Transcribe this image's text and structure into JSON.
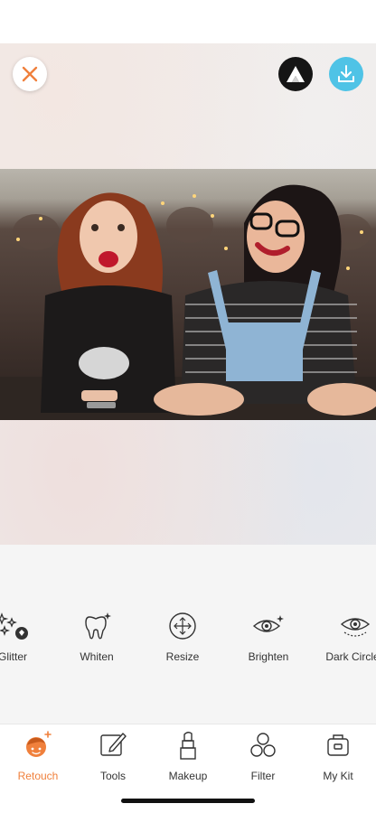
{
  "tools": [
    {
      "label": "Glitter",
      "icon": "glitter-icon"
    },
    {
      "label": "Whiten",
      "icon": "tooth-icon"
    },
    {
      "label": "Resize",
      "icon": "resize-icon"
    },
    {
      "label": "Brighten",
      "icon": "brighten-eye-icon"
    },
    {
      "label": "Dark Circles",
      "icon": "dark-circles-eye-icon"
    }
  ],
  "nav": [
    {
      "label": "Retouch",
      "icon": "retouch-face-icon",
      "active": true
    },
    {
      "label": "Tools",
      "icon": "pencil-edit-icon",
      "active": false
    },
    {
      "label": "Makeup",
      "icon": "lipstick-icon",
      "active": false
    },
    {
      "label": "Filter",
      "icon": "filter-circles-icon",
      "active": false
    },
    {
      "label": "My Kit",
      "icon": "kit-bag-icon",
      "active": false
    }
  ],
  "colors": {
    "accent": "#f0803c",
    "download": "#4fc3e6",
    "brand": "#151515"
  }
}
